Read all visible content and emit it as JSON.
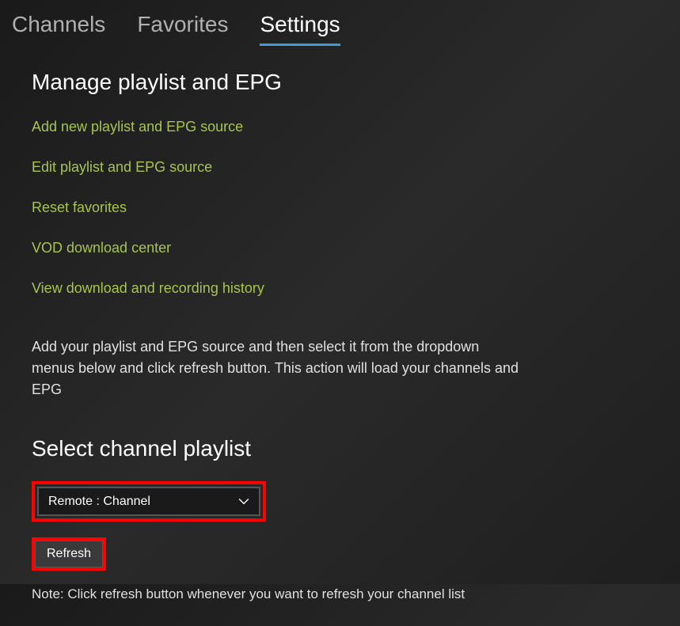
{
  "tabs": {
    "channels": "Channels",
    "favorites": "Favorites",
    "settings": "Settings"
  },
  "manage": {
    "title": "Manage playlist and EPG",
    "links": {
      "add": "Add new playlist and EPG source",
      "edit": "Edit playlist and EPG source",
      "reset": "Reset favorites",
      "vod": "VOD download center",
      "history": "View download and recording history"
    },
    "description": "Add your playlist and EPG source and then select it from the dropdown menus below and click refresh button. This action will load your channels and EPG"
  },
  "select": {
    "title": "Select channel playlist",
    "dropdown_value": "Remote : Channel",
    "refresh_label": "Refresh",
    "note": "Note: Click refresh button whenever you want to refresh your channel list"
  },
  "colors": {
    "accent_link": "#a8c44a",
    "tab_active_underline": "#3d9bdb",
    "highlight_border": "#ff0000"
  }
}
